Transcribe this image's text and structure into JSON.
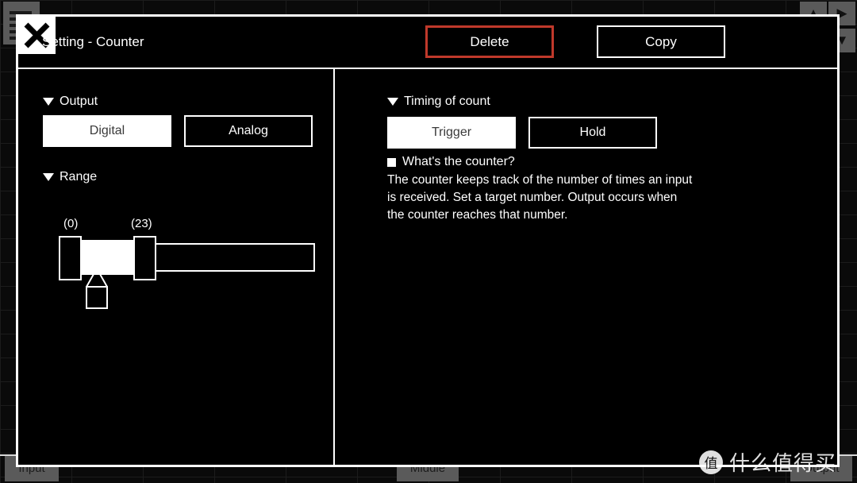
{
  "backdrop": {
    "menu_icon": "menu-lines-icon",
    "arrow_up": "▲",
    "arrow_right": "▶",
    "arrow_down": "▼",
    "tabs": [
      {
        "label": "Input"
      },
      {
        "label": "Middle"
      },
      {
        "label": "Output"
      }
    ]
  },
  "dialog": {
    "title": "Setting - Counter",
    "header": {
      "delete_label": "Delete",
      "copy_label": "Copy",
      "close_icon": "close-icon",
      "delete_border_color": "#c0392b"
    },
    "left": {
      "output": {
        "heading": "Output",
        "options": [
          {
            "label": "Digital",
            "selected": true
          },
          {
            "label": "Analog",
            "selected": false
          }
        ]
      },
      "range": {
        "heading": "Range",
        "min_label": "(0)",
        "max_label": "(23)",
        "min_value": 0,
        "max_value": 23,
        "pointer_icon": "range-pointer-icon"
      }
    },
    "right": {
      "timing": {
        "heading": "Timing of count",
        "options": [
          {
            "label": "Trigger",
            "selected": true
          },
          {
            "label": "Hold",
            "selected": false
          }
        ]
      },
      "info": {
        "title": "What's the counter?",
        "body": "The counter keeps track of the number of times an input\nis received. Set a target number. Output occurs when\nthe counter reaches that number."
      }
    }
  },
  "watermark": {
    "badge": "值",
    "text": "什么值得买"
  }
}
